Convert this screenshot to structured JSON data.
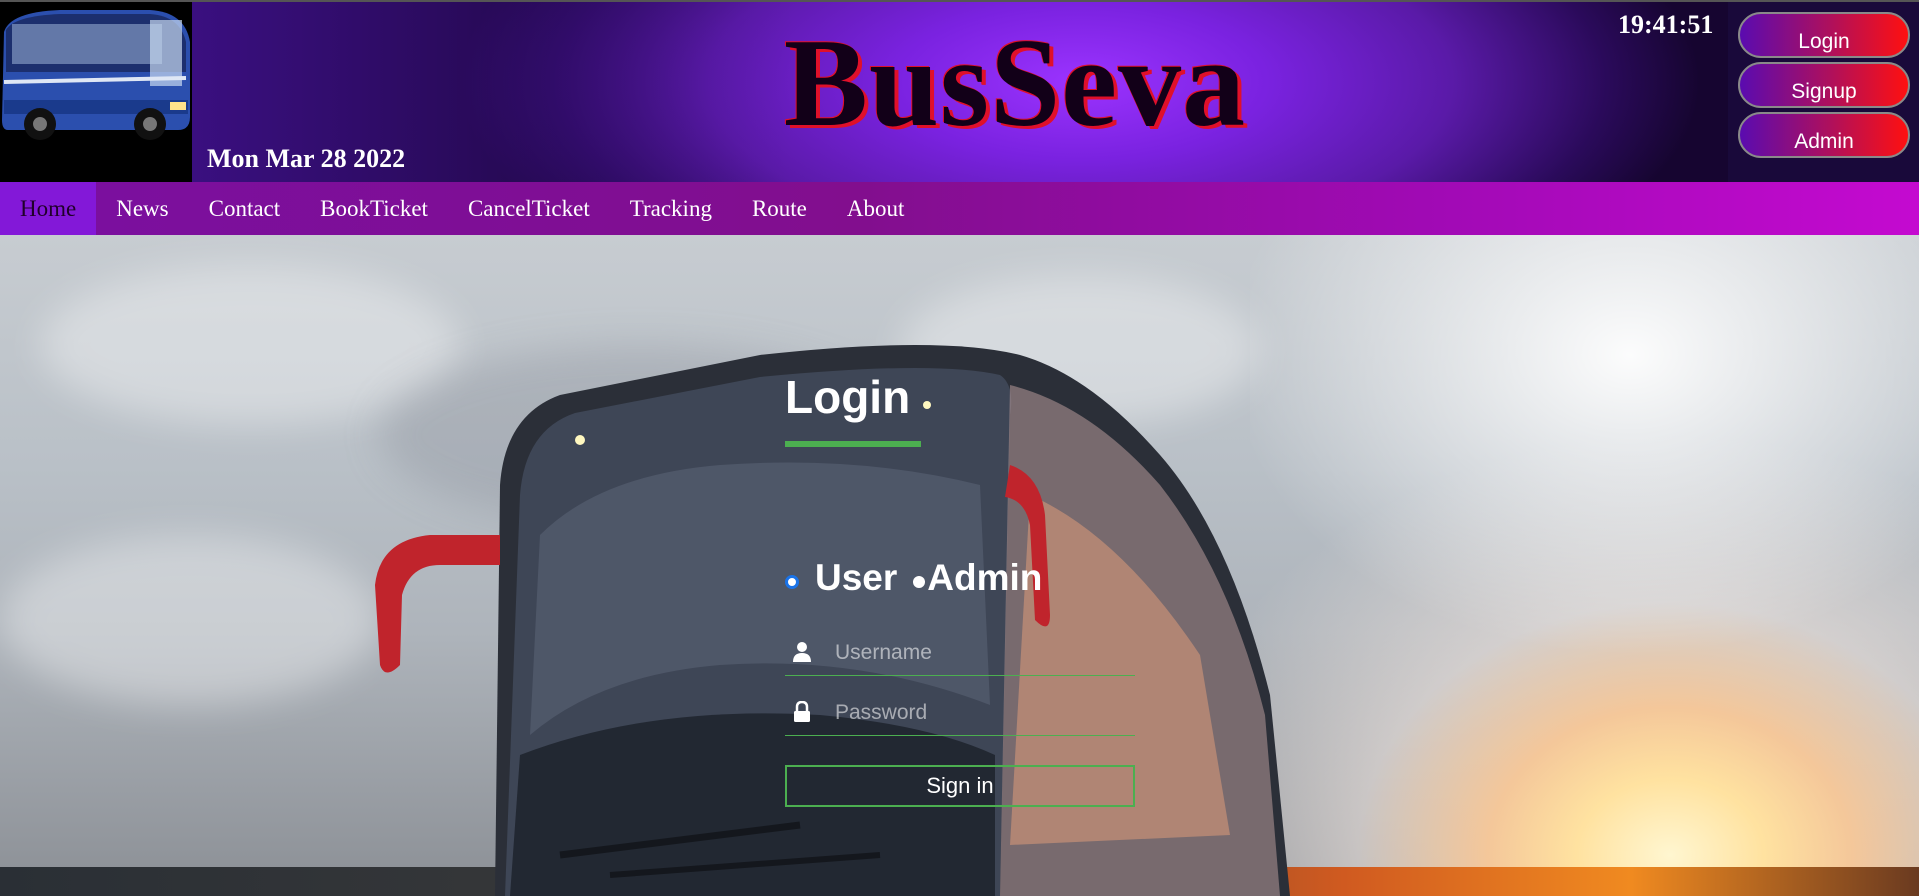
{
  "header": {
    "brand": "BusSeva",
    "date": "Mon Mar 28 2022",
    "clock": "19:41:51",
    "logo_icon": "bus-logo-image"
  },
  "auth": {
    "login_label": "Login",
    "signup_label": "Signup",
    "admin_label": "Admin"
  },
  "nav": {
    "items": [
      "Home",
      "News",
      "Contact",
      "BookTicket",
      "CancelTicket",
      "Tracking",
      "Route",
      "About"
    ],
    "active": "Home"
  },
  "login": {
    "title": "Login",
    "roles": [
      "User",
      "Admin"
    ],
    "selected_role": "User",
    "username_placeholder": "Username",
    "password_placeholder": "Password",
    "username_value": "",
    "password_value": "",
    "signin_label": "Sign in"
  },
  "colors": {
    "accent_green": "#4caf50",
    "nav_purple": "#820e8e",
    "header_purple": "#9b33ff",
    "button_red": "#ff1010"
  }
}
